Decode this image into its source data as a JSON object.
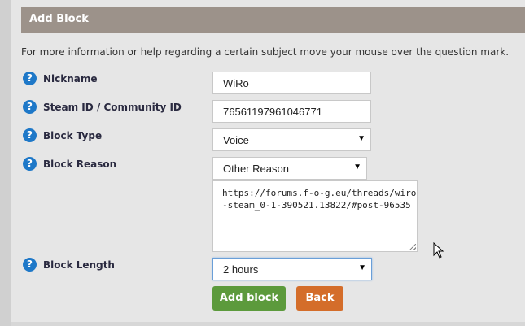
{
  "header": {
    "title": "Add Block"
  },
  "hint": "For more information or help regarding a certain subject move your mouse over the question mark.",
  "help_icon_glyph": "?",
  "form": {
    "nickname": {
      "label": "Nickname",
      "value": "WiRo"
    },
    "steam_id": {
      "label": "Steam ID / Community ID",
      "value": "76561197961046771"
    },
    "block_type": {
      "label": "Block Type",
      "selected": "Voice"
    },
    "block_reason": {
      "label": "Block Reason",
      "selected": "Other Reason",
      "other_text": "https://forums.f-o-g.eu/threads/wiro-steam_0-1-390521.13822/#post-96535"
    },
    "block_length": {
      "label": "Block Length",
      "selected": "2 hours"
    }
  },
  "buttons": {
    "add": "Add block",
    "back": "Back"
  },
  "colors": {
    "header_bg": "#9c928a",
    "help_icon": "#1e78c8",
    "add_button": "#5c9a3c",
    "back_button": "#d46d2a"
  }
}
